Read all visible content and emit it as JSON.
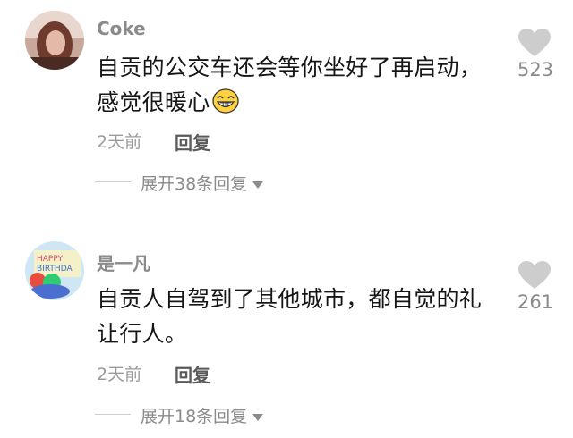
{
  "comments": [
    {
      "username": "Coke",
      "text": "自贡的公交车还会等你坐好了再启动，感觉很暖心",
      "emoji": "grinning-face-emoji",
      "time": "2天前",
      "reply_label": "回复",
      "likes": "523",
      "expand_label": "展开38条回复"
    },
    {
      "username": "是一凡",
      "text": "自贡人自驾到了其他城市，都自觉的礼让行人。",
      "time": "2天前",
      "reply_label": "回复",
      "likes": "261",
      "expand_label": "展开18条回复"
    }
  ],
  "icons": {
    "like": "heart-icon",
    "expand": "caret-down-icon"
  },
  "colors": {
    "secondary_text": "#8b8b8b",
    "heart": "#cdcdcd"
  }
}
